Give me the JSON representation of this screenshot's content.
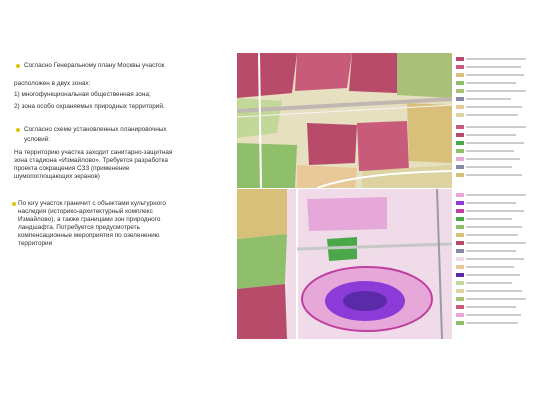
{
  "text": {
    "p1": "Согласно Генеральному плану Москвы участок",
    "p2": "расположен в двух зонах:",
    "p3": "1) многофункциональная общественная зона;",
    "p4": "2) зона особо охраняемых природных территорий.",
    "p5a": "Согласно схеме установленных планировочных",
    "p5b": "условий:",
    "p6a": "На территорию участка заходит санитарно-защитная",
    "p6b": "зона стадиона «Измайлово». Требуется разработка",
    "p6c": "проекта сокращения СЗЗ (применение",
    "p6d": "шумопоглощающих экранов)",
    "p7a": "По югу участок граничит с объектами культурного",
    "p7b": "наследия (историко-архитектурный комплекс",
    "p7c": "Измайлово), а также границами зон природного",
    "p7d": "ландшафта. Потребуется предусмотреть",
    "p7e": "компенсационные мероприятия по озеленению",
    "p7f": "территории"
  },
  "colors": {
    "bullet": "#d8c400",
    "text": "#333333",
    "zone_public": "#b84a6a",
    "zone_green": "#8fbf6a",
    "zone_residential": "#d8c07a",
    "zone_industrial": "#8a8aa8",
    "zone_protect": "#e6a8d8",
    "zone_stadium": "#8c3ad8"
  }
}
